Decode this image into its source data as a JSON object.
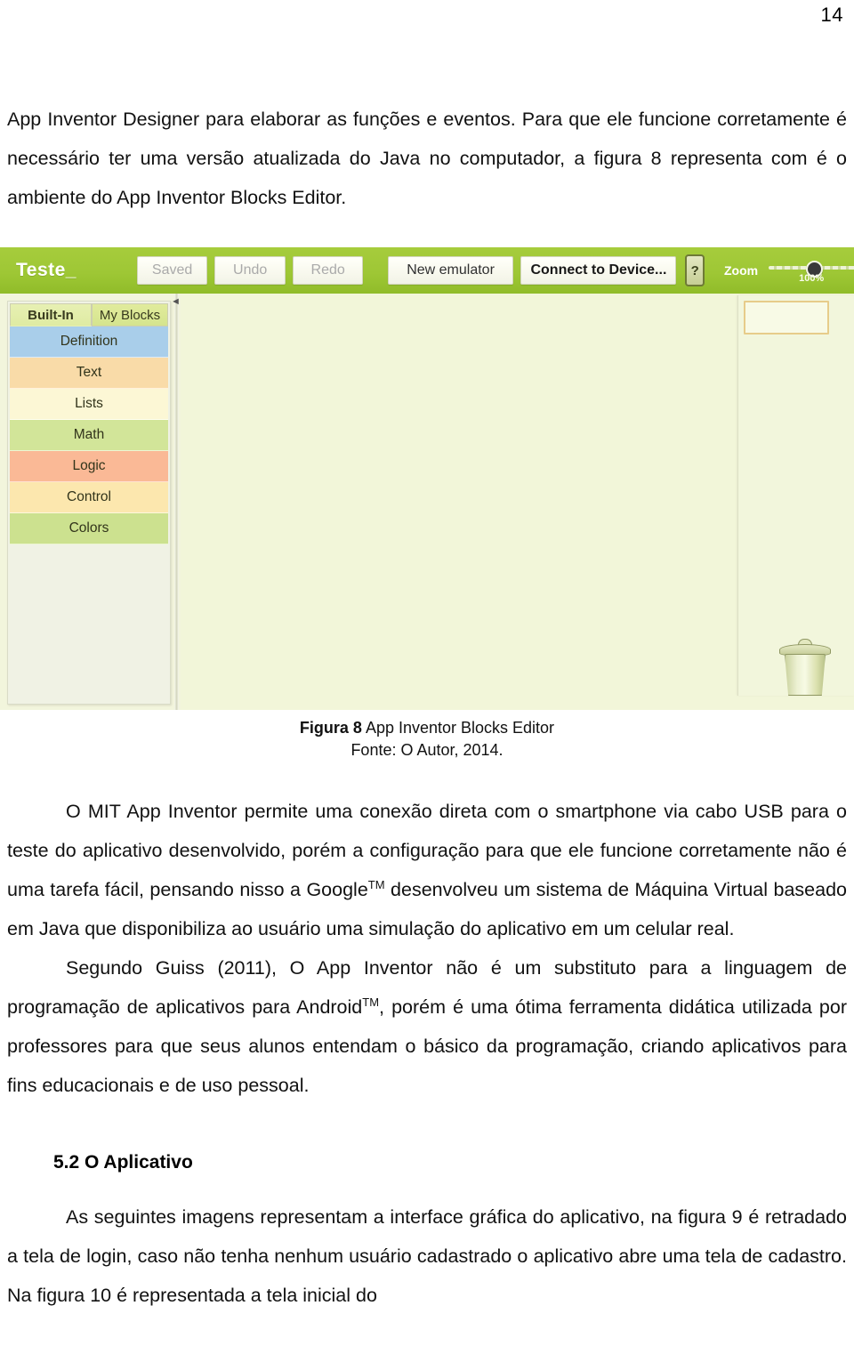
{
  "page": {
    "number": "14"
  },
  "paragraphs": {
    "p1": "App Inventor Designer para elaborar as funções e eventos. Para que ele funcione corretamente é necessário ter uma versão atualizada do Java no computador, a figura 8 representa com é o ambiente do App Inventor Blocks Editor.",
    "p2_a": "O MIT App Inventor permite uma conexão direta com o smartphone via cabo USB para o teste do aplicativo desenvolvido, porém a configuração para que ele funcione corretamente não é uma tarefa fácil, pensando nisso a Google",
    "p2_sup": "TM",
    "p2_b": " desenvolveu um sistema de Máquina Virtual baseado em Java que disponibiliza ao usuário uma simulação do aplicativo em um celular real.",
    "p3_a": "Segundo Guiss (2011), O App Inventor não é um substituto para a linguagem de programação de aplicativos para Android",
    "p3_sup": "TM",
    "p3_b": ", porém é uma ótima ferramenta didática utilizada por professores para que seus alunos entendam o básico da programação, criando aplicativos para fins educacionais e de uso pessoal.",
    "p4": "As seguintes imagens representam a interface gráfica do aplicativo, na figura 9 é retradado a tela de login, caso não tenha nenhum usuário cadastrado o aplicativo abre uma tela de cadastro. Na figura 10 é representada a tela inicial do"
  },
  "section": {
    "title": "5.2 O Aplicativo"
  },
  "figure": {
    "caption_bold": "Figura 8",
    "caption_rest": " App Inventor Blocks Editor",
    "source": "Fonte: O Autor, 2014."
  },
  "screenshot": {
    "toolbar": {
      "project_name": "Teste_",
      "saved_label": "Saved",
      "undo_label": "Undo",
      "redo_label": "Redo",
      "new_emulator_label": "New emulator",
      "connect_label": "Connect to Device...",
      "help_label": "?",
      "zoom_label": "Zoom",
      "zoom_percent": "100%",
      "accent_green": "#9dc438"
    },
    "palette": {
      "tabs": [
        {
          "label": "Built-In",
          "active": true
        },
        {
          "label": "My Blocks",
          "active": false
        }
      ],
      "categories": [
        {
          "label": "Definition",
          "color": "#a7cbe6"
        },
        {
          "label": "Text",
          "color": "#f4d7a6"
        },
        {
          "label": "Lists",
          "color": "#f7f2d2"
        },
        {
          "label": "Math",
          "color": "#cfe198"
        },
        {
          "label": "Logic",
          "color": "#f5b795"
        },
        {
          "label": "Control",
          "color": "#f7e3ac"
        },
        {
          "label": "Colors",
          "color": "#c9dd8e"
        }
      ]
    },
    "canvas": {
      "background": "#eef1d6",
      "trash_icon": "trash-can-icon",
      "collapse_arrow": "◄"
    }
  }
}
